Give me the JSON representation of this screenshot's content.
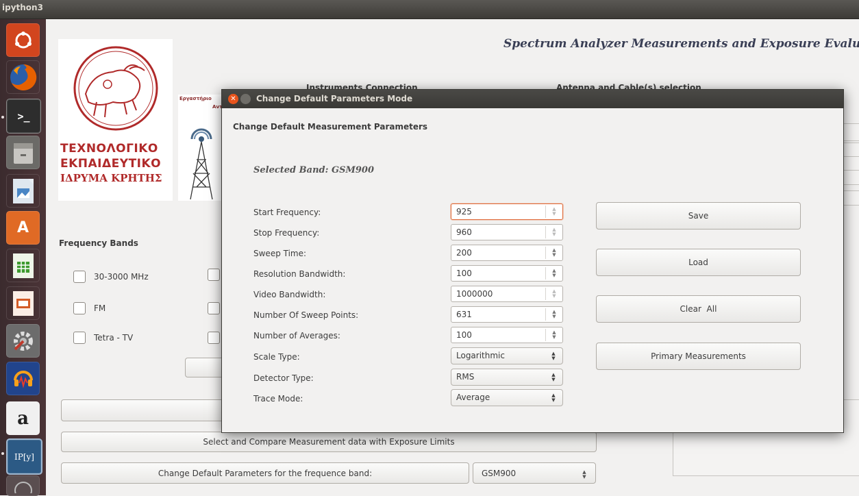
{
  "app": {
    "window_title": "ipython3"
  },
  "launcher": {
    "items": [
      {
        "name": "dash-icon"
      },
      {
        "name": "firefox-icon"
      },
      {
        "name": "terminal-icon"
      },
      {
        "name": "files-icon"
      },
      {
        "name": "image-viewer-icon"
      },
      {
        "name": "software-center-icon"
      },
      {
        "name": "spreadsheet-icon"
      },
      {
        "name": "presentation-icon"
      },
      {
        "name": "system-settings-icon"
      },
      {
        "name": "audacity-icon"
      },
      {
        "name": "amazon-icon"
      },
      {
        "name": "ipython-icon"
      }
    ],
    "amazon_glyph": "a",
    "ipython_glyph": "IP[y]"
  },
  "main": {
    "header": "Spectrum Analyzer Measurements and Exposure Evalu",
    "logo_text": [
      "ΤΕΧΝΟΛΟΓΙΚΟ",
      "ΕΚΠΑΙΔΕΥΤΙΚΟ",
      "ΙΔΡΥΜΑ ΚΡΗΤΗΣ"
    ],
    "lab_caption": "Εργαστήριο",
    "lab_caption_2": "Αντ",
    "instruments_heading": "Instruments Connection",
    "antenna_heading": "Antenna and Cable(s) selection",
    "frequency_bands": {
      "title": "Frequency Bands",
      "options": [
        "30-3000 MHz",
        "FM",
        "Tetra - TV"
      ]
    },
    "compare_button": "Select and Compare Measurement data with Exposure Limits",
    "change_defaults_button": "Change Default Parameters for the frequence band:",
    "band_select": "GSM900"
  },
  "dialog": {
    "title": "Change Default Parameters Mode",
    "heading": "Change Default Measurement Parameters",
    "selected_band_label": "Selected Band:",
    "selected_band_value": "GSM900",
    "params": [
      {
        "label": "Start Frequency:",
        "value": "925"
      },
      {
        "label": "Stop Frequency:",
        "value": "960"
      },
      {
        "label": "Sweep Time:",
        "value": "200"
      },
      {
        "label": "Resolution Bandwidth:",
        "value": "100"
      },
      {
        "label": "Video Bandwidth:",
        "value": "1000000"
      },
      {
        "label": "Number Of Sweep Points:",
        "value": "631"
      },
      {
        "label": "Number of Averages:",
        "value": "100"
      },
      {
        "label": "Scale Type:",
        "value": "Logarithmic"
      },
      {
        "label": "Detector Type:",
        "value": "RMS"
      },
      {
        "label": "Trace Mode:",
        "value": "Average"
      }
    ],
    "buttons": {
      "save": "Save",
      "load": "Load",
      "clear": "Clear  All",
      "primary": "Primary Measurements"
    }
  },
  "colors": {
    "launcher_bg": "#4b3437",
    "titlebar": "#3d3b37",
    "logo_red": "#b02a2a",
    "focus": "#e06a38",
    "close_button": "#e9541c"
  }
}
